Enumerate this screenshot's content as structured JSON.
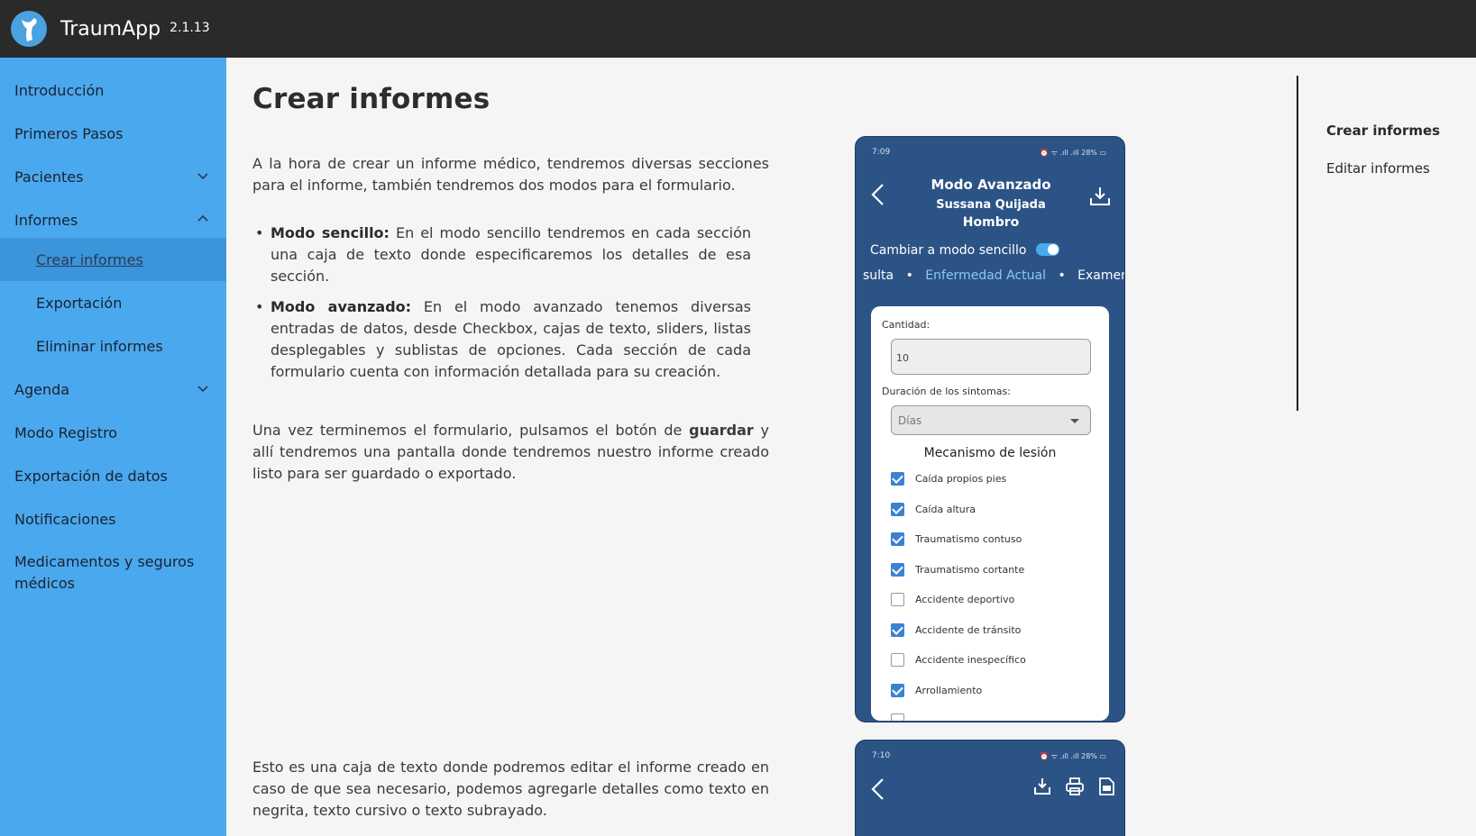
{
  "app": {
    "name": "TraumApp",
    "version": "2.1.13"
  },
  "sidebar": {
    "items": [
      {
        "label": "Introducción"
      },
      {
        "label": "Primeros Pasos"
      },
      {
        "label": "Pacientes"
      },
      {
        "label": "Informes"
      },
      {
        "label": "Crear informes"
      },
      {
        "label": "Exportación"
      },
      {
        "label": "Eliminar informes"
      },
      {
        "label": "Agenda"
      },
      {
        "label": "Modo Registro"
      },
      {
        "label": "Exportación de datos"
      },
      {
        "label": "Notificaciones"
      },
      {
        "label": "Medicamentos y seguros",
        "label2": "médicos"
      }
    ]
  },
  "main": {
    "title": "Crear informes",
    "intro": "A la hora de crear un informe médico, tendremos diversas secciones para el informe, también tendremos dos modos para el formulario.",
    "bullets": [
      {
        "term": "Modo sencillo:",
        "text": " En el modo sencillo tendremos en cada sección una caja de texto donde especificaremos los detalles de esa sección."
      },
      {
        "term": "Modo avanzado:",
        "text": " En el modo avanzado tenemos diversas entradas de datos, desde Checkbox, cajas de texto, sliders, listas desplegables y sublistas de opciones. Cada sección de cada formulario cuenta con información detallada para su creación."
      }
    ],
    "para2_a": "Una vez terminemos el formulario, pulsamos el botón de ",
    "para2_b": "guardar",
    "para2_c": " y allí tendremos una pantalla donde tendremos nuestro informe creado listo para ser guardado o exportado.",
    "para3": "Esto es una caja de texto donde podremos editar el informe creado en caso de que sea necesario, podemos agregarle detalles como texto en negrita, texto cursivo o texto subrayado."
  },
  "toc": {
    "items": [
      {
        "label": "Crear informes"
      },
      {
        "label": "Editar informes"
      }
    ]
  },
  "phone1": {
    "time": "7:09",
    "status_icons": "⏰ ᯤ .ıll .ıll 28% ▭",
    "title": "Modo Avanzado",
    "patient": "Sussana Quijada",
    "area": "Hombro",
    "switch_label": "Cambiar a modo sencillo",
    "tabs": {
      "prev": "sulta",
      "active": "Enfermedad Actual",
      "next": "Examen"
    },
    "form": {
      "cantidad_label": "Cantidad:",
      "cantidad_value": "10",
      "duracion_label": "Duración de los sintomas:",
      "duracion_value": "Días",
      "mecanismo_title": "Mecanismo de lesión",
      "checkboxes": [
        {
          "label": "Caída propios pies",
          "checked": true
        },
        {
          "label": "Caída altura",
          "checked": true
        },
        {
          "label": "Traumatismo contuso",
          "checked": true
        },
        {
          "label": "Traumatismo cortante",
          "checked": true
        },
        {
          "label": "Accidente deportivo",
          "checked": false
        },
        {
          "label": "Accidente de tránsito",
          "checked": true
        },
        {
          "label": "Accidente inespecífico",
          "checked": false
        },
        {
          "label": "Arrollamiento",
          "checked": true
        }
      ]
    }
  },
  "phone2": {
    "time": "7:10",
    "status_icons": "⏰ ᯤ .ıll .ıll 28% ▭"
  },
  "colors": {
    "topbar": "#2a2a2a",
    "sidebar": "#4aa8ee",
    "phone": "#2c5386",
    "accent": "#3b82d0"
  }
}
